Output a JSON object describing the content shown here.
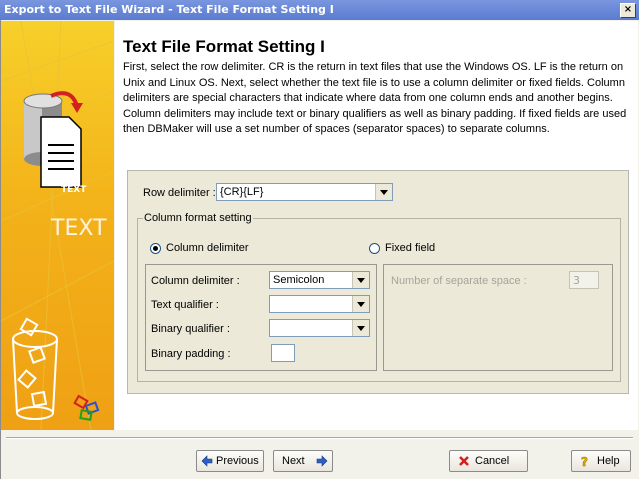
{
  "window": {
    "title": "Export to Text File Wizard - Text File Format Setting I",
    "close_label": "×"
  },
  "sidebar": {
    "text_label_small": "TEXT",
    "text_label_big": "TEXT"
  },
  "page": {
    "heading": "Text File Format Setting I",
    "description": "First, select the row delimiter. CR is the return in text files that use the Windows OS. LF is the return on Unix and Linux OS. Next, select whether the text file is to use a column delimiter or fixed fields. Column delimiters are special characters that indicate where data from one column ends and another begins. Column delimiters may include text or binary qualifiers as well as binary padding. If fixed fields are used then DBMaker will use a set number of spaces (separator spaces) to separate columns."
  },
  "form": {
    "row_delimiter_label": "Row delimiter :",
    "row_delimiter_value": "{CR}{LF}",
    "column_format_title": "Column format setting",
    "column_delimiter_radio": "Column delimiter",
    "fixed_field_radio": "Fixed field",
    "column_delimiter_label": "Column delimiter :",
    "column_delimiter_value": "Semicolon",
    "text_qualifier_label": "Text qualifier :",
    "text_qualifier_value": "",
    "binary_qualifier_label": "Binary qualifier :",
    "binary_qualifier_value": "",
    "binary_padding_label": "Binary padding :",
    "binary_padding_value": "",
    "separate_space_label": "Number of separate space :",
    "separate_space_value": "3",
    "selected_mode": "column_delimiter"
  },
  "buttons": {
    "previous": "Previous",
    "next": "Next",
    "cancel": "Cancel",
    "help": "Help"
  },
  "colors": {
    "accent": "#f3b219",
    "title_bar": "#7a96df"
  }
}
